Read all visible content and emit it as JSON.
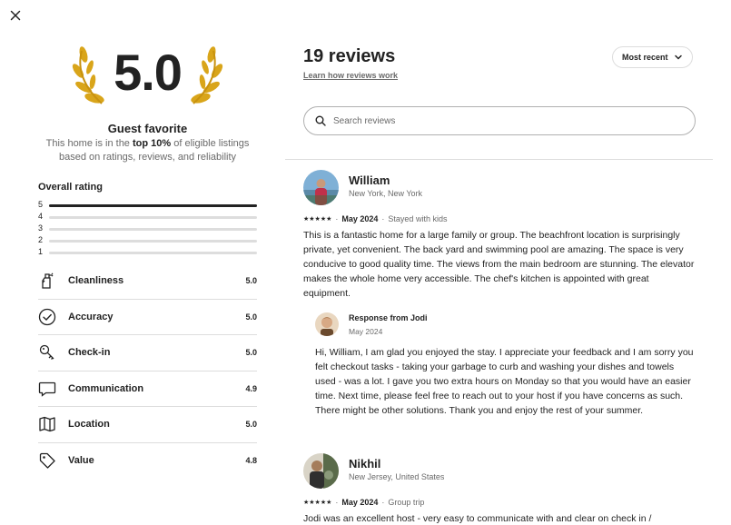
{
  "modal": {
    "close_icon": "close-icon"
  },
  "summary": {
    "rating": "5.0",
    "badge": "Guest favorite",
    "desc_pre": "This home is in the ",
    "desc_bold": "top 10%",
    "desc_post": " of eligible listings based on ratings, reviews, and reliability"
  },
  "overall": {
    "title": "Overall rating",
    "distribution": [
      {
        "stars": "5",
        "fraction": 1.0
      },
      {
        "stars": "4",
        "fraction": 0.0
      },
      {
        "stars": "3",
        "fraction": 0.0
      },
      {
        "stars": "2",
        "fraction": 0.0
      },
      {
        "stars": "1",
        "fraction": 0.0
      }
    ]
  },
  "categories": [
    {
      "label": "Cleanliness",
      "value": "5.0",
      "icon": "spray-bottle-icon"
    },
    {
      "label": "Accuracy",
      "value": "5.0",
      "icon": "check-circle-icon"
    },
    {
      "label": "Check-in",
      "value": "5.0",
      "icon": "key-icon"
    },
    {
      "label": "Communication",
      "value": "4.9",
      "icon": "chat-bubble-icon"
    },
    {
      "label": "Location",
      "value": "5.0",
      "icon": "map-icon"
    },
    {
      "label": "Value",
      "value": "4.8",
      "icon": "tag-icon"
    }
  ],
  "reviews_header": {
    "count": "19 reviews",
    "learn_link": "Learn how reviews work",
    "sort_label": "Most recent",
    "search_placeholder": "Search reviews"
  },
  "reviews": [
    {
      "name": "William",
      "location": "New York, New York",
      "stars": "★★★★★",
      "date": "May 2024",
      "trip": "Stayed with kids",
      "text": "This is a fantastic home for a large family or group. The beachfront location is surprisingly private, yet convenient. The back yard and swimming pool are amazing. The space is very conducive to good quality time. The views from the main bedroom are stunning. The elevator makes the whole home very accessible. The chef's kitchen is appointed with great equipment.",
      "response": {
        "title": "Response from Jodi",
        "date": "May 2024",
        "text": "Hi, William, I am glad you enjoyed the stay. I appreciate your feedback and I am sorry you felt checkout tasks - taking your garbage to curb and washing your dishes and towels used - was a lot. I gave you two extra hours on Monday so that you would have an easier time. Next time, please feel free to reach out to your host if you have concerns as such. There might be other solutions. Thank you and enjoy the rest of your summer."
      }
    },
    {
      "name": "Nikhil",
      "location": "New Jersey, United States",
      "stars": "★★★★★",
      "date": "May 2024",
      "trip": "Group trip",
      "text": "Jodi was an excellent host - very easy to communicate with and clear on check in /"
    }
  ],
  "separator": "·"
}
